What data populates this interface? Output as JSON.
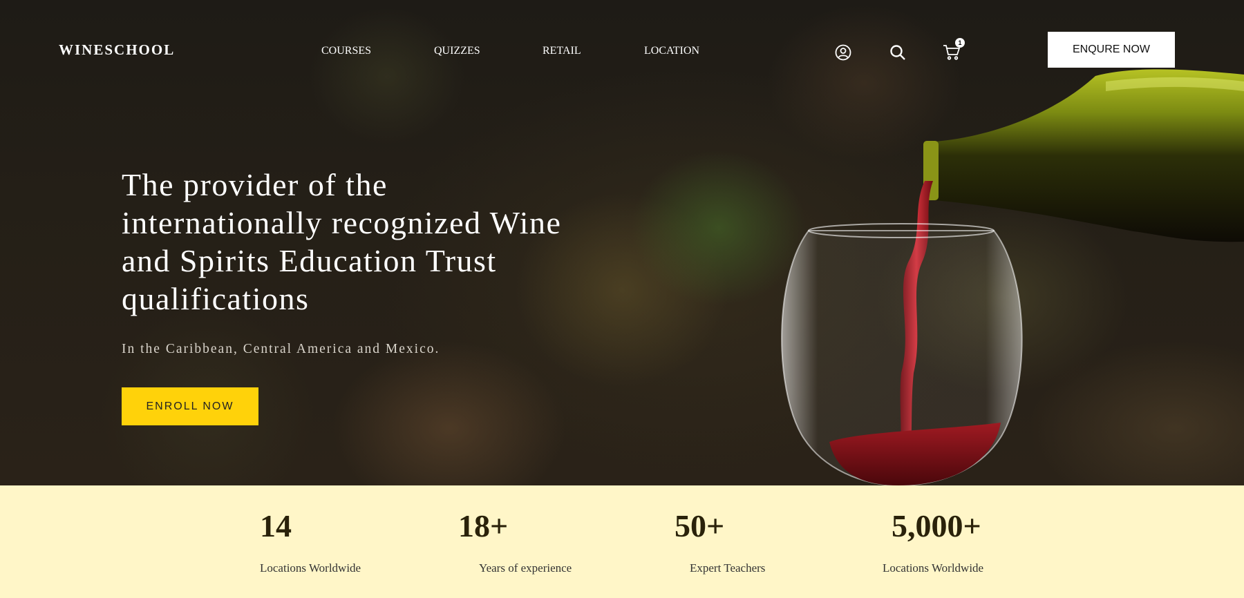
{
  "header": {
    "logo": "WINESCHOOL",
    "nav": [
      {
        "label": "COURSES"
      },
      {
        "label": "QUIZZES"
      },
      {
        "label": "RETAIL"
      },
      {
        "label": "LOCATION"
      }
    ],
    "icons": {
      "account": "user-circle-icon",
      "search": "search-icon",
      "cart": "cart-icon"
    },
    "cart_count": "1",
    "cta_label": "ENQURE NOW"
  },
  "hero": {
    "title": "The provider of the internationally recognized Wine and Spirits Education Trust qualifications",
    "subtitle": "In the Caribbean, Central America and Mexico.",
    "cta_label": "ENROLL NOW"
  },
  "stats": [
    {
      "value": "14",
      "label": "Locations Worldwide"
    },
    {
      "value": "18+",
      "label": "Years of experience"
    },
    {
      "value": "50+",
      "label": "Expert Teachers"
    },
    {
      "value": "5,000+",
      "label": "Locations Worldwide"
    }
  ],
  "colors": {
    "accent": "#ffd20a",
    "stats_bg": "#fff6c8",
    "stats_text": "#2a220a",
    "wine": "#7a0f16",
    "bottle": "#6f7d12"
  }
}
